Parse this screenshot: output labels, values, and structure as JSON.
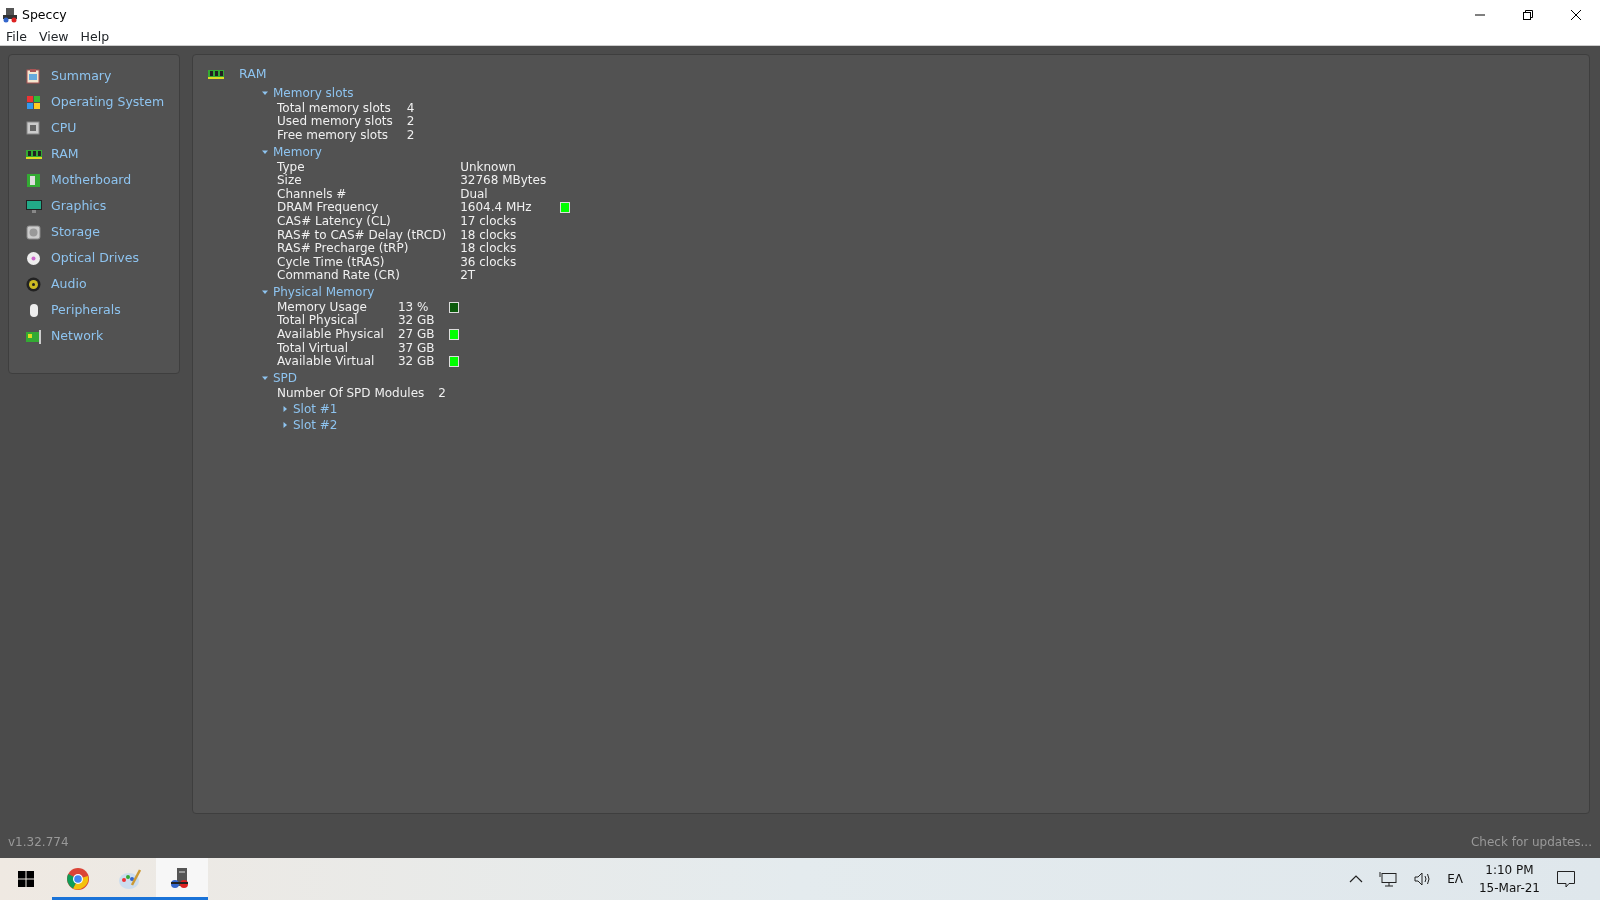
{
  "window": {
    "title": "Speccy"
  },
  "menu": [
    "File",
    "View",
    "Help"
  ],
  "sidebar": {
    "items": [
      {
        "label": "Summary",
        "kind": "summary"
      },
      {
        "label": "Operating System",
        "kind": "os"
      },
      {
        "label": "CPU",
        "kind": "cpu"
      },
      {
        "label": "RAM",
        "kind": "ram"
      },
      {
        "label": "Motherboard",
        "kind": "motherboard"
      },
      {
        "label": "Graphics",
        "kind": "graphics"
      },
      {
        "label": "Storage",
        "kind": "storage"
      },
      {
        "label": "Optical Drives",
        "kind": "optical"
      },
      {
        "label": "Audio",
        "kind": "audio"
      },
      {
        "label": "Peripherals",
        "kind": "peripherals"
      },
      {
        "label": "Network",
        "kind": "network"
      }
    ]
  },
  "content": {
    "title": "RAM",
    "sections": [
      {
        "label": "Memory slots",
        "expanded": true,
        "rows": [
          {
            "label": "Total memory slots",
            "value": "4"
          },
          {
            "label": "Used memory slots",
            "value": "2"
          },
          {
            "label": "Free memory slots",
            "value": "2"
          }
        ]
      },
      {
        "label": "Memory",
        "expanded": true,
        "rows": [
          {
            "label": "Type",
            "value": "Unknown"
          },
          {
            "label": "Size",
            "value": "32768 MBytes"
          },
          {
            "label": "Channels #",
            "value": "Dual"
          },
          {
            "label": "DRAM Frequency",
            "value": "1604.4 MHz",
            "color": "#00ff00"
          },
          {
            "label": "CAS# Latency (CL)",
            "value": "17 clocks"
          },
          {
            "label": "RAS# to CAS# Delay (tRCD)",
            "value": "18 clocks"
          },
          {
            "label": "RAS# Precharge (tRP)",
            "value": "18 clocks"
          },
          {
            "label": "Cycle Time (tRAS)",
            "value": "36 clocks"
          },
          {
            "label": "Command Rate (CR)",
            "value": "2T"
          }
        ]
      },
      {
        "label": "Physical Memory",
        "expanded": true,
        "rows": [
          {
            "label": "Memory Usage",
            "value": "13 %",
            "color": "#0b5a0b"
          },
          {
            "label": "Total Physical",
            "value": "32 GB"
          },
          {
            "label": "Available Physical",
            "value": "27 GB",
            "color": "#00ff00"
          },
          {
            "label": "Total Virtual",
            "value": "37 GB"
          },
          {
            "label": "Available Virtual",
            "value": "32 GB",
            "color": "#00ff00"
          }
        ]
      },
      {
        "label": "SPD",
        "expanded": true,
        "rows": [
          {
            "label": "Number Of SPD Modules",
            "value": "2"
          }
        ],
        "children": [
          {
            "label": "Slot #1",
            "expanded": false
          },
          {
            "label": "Slot #2",
            "expanded": false
          }
        ]
      }
    ]
  },
  "status_bar": {
    "version": "v1.32.774",
    "update_link": "Check for updates..."
  },
  "taskbar": {
    "apps": [
      {
        "kind": "chrome",
        "running": true,
        "selected": false
      },
      {
        "kind": "paint",
        "running": true,
        "selected": false
      },
      {
        "kind": "speccy",
        "running": true,
        "selected": true
      }
    ],
    "language": "EΛ",
    "time": "1:10 PM",
    "date": "15-Mar-21"
  }
}
